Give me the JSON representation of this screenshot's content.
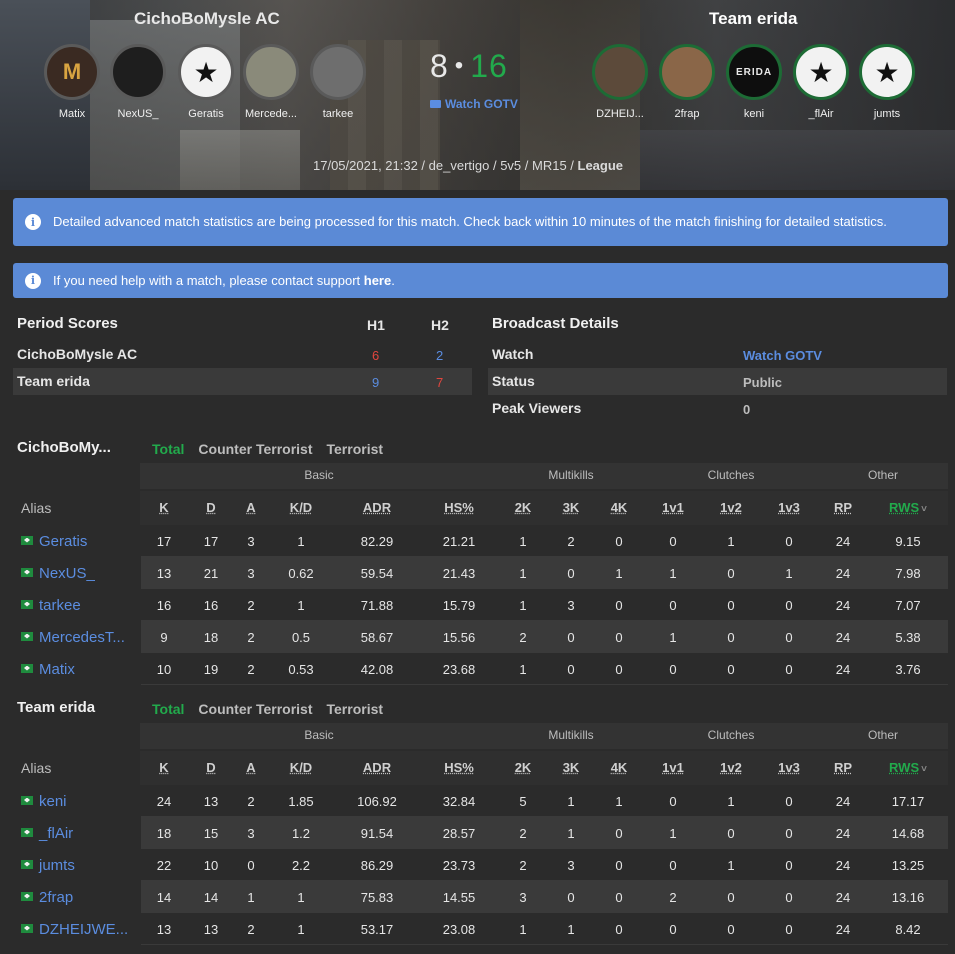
{
  "header": {
    "team_left": "CichoBoMysle AC",
    "team_right": "Team erida",
    "score_left": "8",
    "score_sep": "•",
    "score_right": "16",
    "watch_gotv": "Watch GOTV",
    "meta": "17/05/2021, 21:32 / de_vertigo / 5v5 / MR15 / ",
    "meta_bold": "League",
    "left_players": [
      "Matix",
      "NexUS_",
      "Geratis",
      "Mercede...",
      "tarkee"
    ],
    "right_players": [
      "DZHEIJ...",
      "2frap",
      "keni",
      "_flAir",
      "jumts"
    ]
  },
  "alerts": {
    "processing": "Detailed advanced match statistics are being processed for this match. Check back within 10 minutes of the match finishing for detailed statistics.",
    "help_prefix": "If you need help with a match, please contact support ",
    "help_link": "here",
    "help_suffix": "."
  },
  "period": {
    "title": "Period Scores",
    "h1": "H1",
    "h2": "H2",
    "rows": [
      {
        "team": "CichoBoMysle AC",
        "h1": "6",
        "h2": "2"
      },
      {
        "team": "Team erida",
        "h1": "9",
        "h2": "7"
      }
    ]
  },
  "broadcast": {
    "title": "Broadcast Details",
    "rows": [
      {
        "label": "Watch",
        "value": "Watch GOTV"
      },
      {
        "label": "Status",
        "value": "Public"
      },
      {
        "label": "Peak Viewers",
        "value": "0"
      }
    ]
  },
  "stats_common": {
    "tabs": [
      "Total",
      "Counter Terrorist",
      "Terrorist"
    ],
    "groups": [
      "Basic",
      "Multikills",
      "Clutches",
      "Other"
    ],
    "columns": [
      "Alias",
      "K",
      "D",
      "A",
      "K/D",
      "ADR",
      "HS%",
      "2K",
      "3K",
      "4K",
      "1v1",
      "1v2",
      "1v3",
      "RP",
      "RWS"
    ],
    "sort_indicator": "˅"
  },
  "team1": {
    "name": "CichoBoMy...",
    "rows": [
      {
        "alias": "Geratis",
        "v": [
          "17",
          "17",
          "3",
          "1",
          "82.29",
          "21.21",
          "1",
          "2",
          "0",
          "0",
          "1",
          "0",
          "24",
          "9.15"
        ]
      },
      {
        "alias": "NexUS_",
        "v": [
          "13",
          "21",
          "3",
          "0.62",
          "59.54",
          "21.43",
          "1",
          "0",
          "1",
          "1",
          "0",
          "1",
          "24",
          "7.98"
        ]
      },
      {
        "alias": "tarkee",
        "v": [
          "16",
          "16",
          "2",
          "1",
          "71.88",
          "15.79",
          "1",
          "3",
          "0",
          "0",
          "0",
          "0",
          "24",
          "7.07"
        ]
      },
      {
        "alias": "MercedesT...",
        "v": [
          "9",
          "18",
          "2",
          "0.5",
          "58.67",
          "15.56",
          "2",
          "0",
          "0",
          "1",
          "0",
          "0",
          "24",
          "5.38"
        ]
      },
      {
        "alias": "Matix",
        "v": [
          "10",
          "19",
          "2",
          "0.53",
          "42.08",
          "23.68",
          "1",
          "0",
          "0",
          "0",
          "0",
          "0",
          "24",
          "3.76"
        ]
      }
    ]
  },
  "team2": {
    "name": "Team erida",
    "rows": [
      {
        "alias": "keni",
        "v": [
          "24",
          "13",
          "2",
          "1.85",
          "106.92",
          "32.84",
          "5",
          "1",
          "1",
          "0",
          "1",
          "0",
          "24",
          "17.17"
        ]
      },
      {
        "alias": "_flAir",
        "v": [
          "18",
          "15",
          "3",
          "1.2",
          "91.54",
          "28.57",
          "2",
          "1",
          "0",
          "1",
          "0",
          "0",
          "24",
          "14.68"
        ]
      },
      {
        "alias": "jumts",
        "v": [
          "22",
          "10",
          "0",
          "2.2",
          "86.29",
          "23.73",
          "2",
          "3",
          "0",
          "0",
          "1",
          "0",
          "24",
          "13.25"
        ]
      },
      {
        "alias": "2frap",
        "v": [
          "14",
          "14",
          "1",
          "1",
          "75.83",
          "14.55",
          "3",
          "0",
          "0",
          "2",
          "0",
          "0",
          "24",
          "13.16"
        ]
      },
      {
        "alias": "DZHEIJWE...",
        "v": [
          "13",
          "13",
          "2",
          "1",
          "53.17",
          "23.08",
          "1",
          "1",
          "0",
          "0",
          "0",
          "0",
          "24",
          "8.42"
        ]
      }
    ]
  },
  "colors": {
    "accent_green": "#22aa4c",
    "link_blue": "#5b8de0",
    "alert_blue": "#5b8ad6",
    "loss_red": "#e0463e"
  },
  "icons": {
    "alert": "info-icon",
    "gotv": "video-camera-icon",
    "flag": "flag-icon"
  }
}
